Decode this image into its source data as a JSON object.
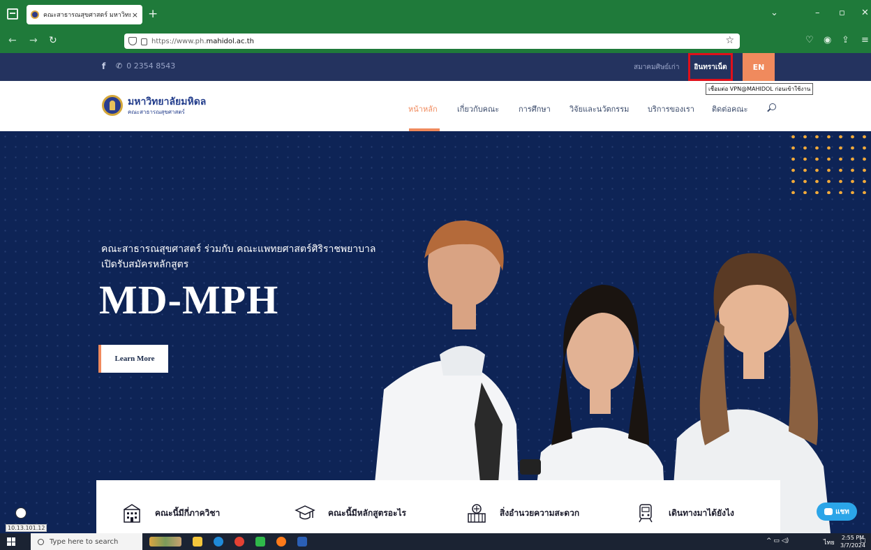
{
  "browser": {
    "tab_title": "คณะสาธารณสุขศาสตร์ มหาวิทยาลัยมหิดล",
    "tab_close": "×",
    "new_tab": "+",
    "url_prefix": "https://www.ph.",
    "url_domain": "mahidol.ac.th",
    "icons": [
      "tab-list-icon",
      "back-icon",
      "forward-icon",
      "reload-icon",
      "shield-icon",
      "lock-icon",
      "bookmark-star-icon",
      "pocket-icon",
      "account-icon",
      "extensions-icon",
      "menu-icon"
    ]
  },
  "topbar": {
    "facebook": "f",
    "phone": "0 2354 8543",
    "alumni": "สมาคมศิษย์เก่า",
    "intranet": "อินทราเน็ต",
    "language": "EN",
    "tooltip": "เชื่อมต่อ VPN@MAHIDOL ก่อนเข้าใช้งาน"
  },
  "header": {
    "logo_name": "มหาวิทยาลัยมหิดล",
    "logo_sub": "คณะสาธารณสุขศาสตร์",
    "menu": [
      {
        "label": "หน้าหลัก",
        "active": true
      },
      {
        "label": "เกี่ยวกับคณะ"
      },
      {
        "label": "การศึกษา"
      },
      {
        "label": "วิจัยและนวัตกรรม"
      },
      {
        "label": "บริการของเรา"
      },
      {
        "label": "ติดต่อคณะ"
      }
    ]
  },
  "hero": {
    "line1": "คณะสาธารณสุขศาสตร์ ร่วมกับ คณะแพทยศาสตร์ศิริราชพยาบาล",
    "line2": "เปิดรับสมัครหลักสูตร",
    "title": "MD-MPH",
    "button": "Learn More"
  },
  "quicklinks": [
    {
      "label": "คณะนี้มีกี่ภาควิชา",
      "icon": "building-icon"
    },
    {
      "label": "คณะนี้มีหลักสูตรอะไร",
      "icon": "graduation-cap-icon"
    },
    {
      "label": "สิ่งอำนวยความสะดวก",
      "icon": "facility-icon"
    },
    {
      "label": "เดินทางมาได้ยังไง",
      "icon": "train-icon"
    }
  ],
  "chat": {
    "label": "แชท"
  },
  "status_ip": "10.13.101.12",
  "taskbar": {
    "search_placeholder": "Type here to search",
    "lang": "ไทย",
    "time": "2:55 PM",
    "date": "3/7/2024"
  },
  "colors": {
    "browser_green": "#1f7a3a",
    "topbar_navy": "#24335f",
    "hero_navy": "#0e2456",
    "accent_orange": "#f08a5d",
    "highlight_red": "#e0101a"
  }
}
